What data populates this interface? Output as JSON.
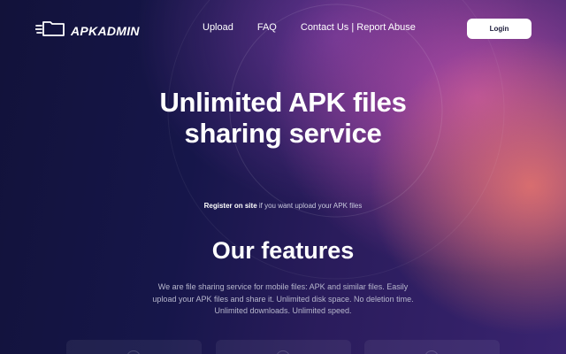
{
  "brand": {
    "name": "APKADMIN",
    "logo_icon": "folder-speed-icon"
  },
  "nav": {
    "links": [
      {
        "label": "Upload"
      },
      {
        "label": "FAQ"
      },
      {
        "label": "Contact Us | Report Abuse"
      }
    ],
    "login_label": "Login"
  },
  "hero": {
    "title_line1": "Unlimited APK files",
    "title_line2": "sharing service",
    "register_link": "Register on site",
    "register_rest": " if you want upload your APK files"
  },
  "features": {
    "title": "Our features",
    "description": "We are file sharing service for mobile files: APK and similar files. Easily upload your APK files and share it. Unlimited disk space. No deletion time. Unlimited downloads. Unlimited speed."
  },
  "colors": {
    "background_dark": "#14143c",
    "accent_pink": "#be50aa",
    "accent_coral": "#de706e",
    "button_bg": "#ffffff",
    "button_text": "#1b1b3a"
  }
}
